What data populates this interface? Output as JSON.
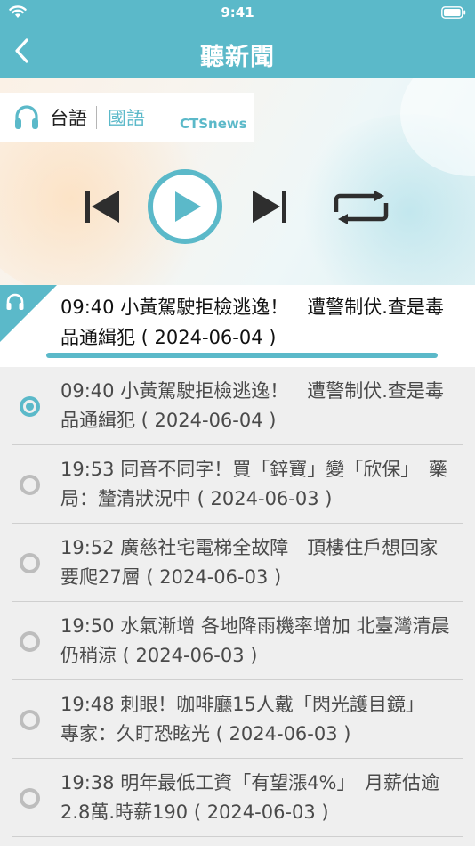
{
  "status": {
    "time": "9:41"
  },
  "nav": {
    "title": "聽新聞"
  },
  "player": {
    "lang_taiwanese": "台語",
    "lang_mandarin": "國語",
    "brand": "CTSnews"
  },
  "now_playing": {
    "text": "09:40 小黃駕駛拒檢逃逸！　遭警制伏.查是毒品通緝犯 ( 2024-06-04 )"
  },
  "list": {
    "items": [
      {
        "text": "09:40 小黃駕駛拒檢逃逸！　遭警制伏.查是毒品通緝犯 ( 2024-06-04 )"
      },
      {
        "text": "19:53 同音不同字！買「鋅寶」變「欣保」　藥局：釐清狀況中 ( 2024-06-03 )"
      },
      {
        "text": "19:52 廣慈社宅電梯全故障　頂樓住戶想回家要爬27層 ( 2024-06-03 )"
      },
      {
        "text": "19:50 水氣漸增 各地降雨機率增加 北臺灣清晨仍稍涼 ( 2024-06-03 )"
      },
      {
        "text": "19:48 刺眼！咖啡廳15人戴「閃光護目鏡」　專家：久盯恐眩光 ( 2024-06-03 )"
      },
      {
        "text": "19:38 明年最低工資「有望漲4%」　月薪估逾2.8萬.時薪190 ( 2024-06-03 )"
      }
    ]
  },
  "colors": {
    "accent": "#5bb9c9",
    "header": "#5bb9c9",
    "radio_inactive": "#bdbdbd"
  },
  "icons": {
    "back": "chevron-left-icon",
    "headphones": "headphones-icon",
    "prev": "skip-previous-icon",
    "play": "play-icon",
    "next": "skip-next-icon",
    "repeat": "repeat-icon"
  }
}
